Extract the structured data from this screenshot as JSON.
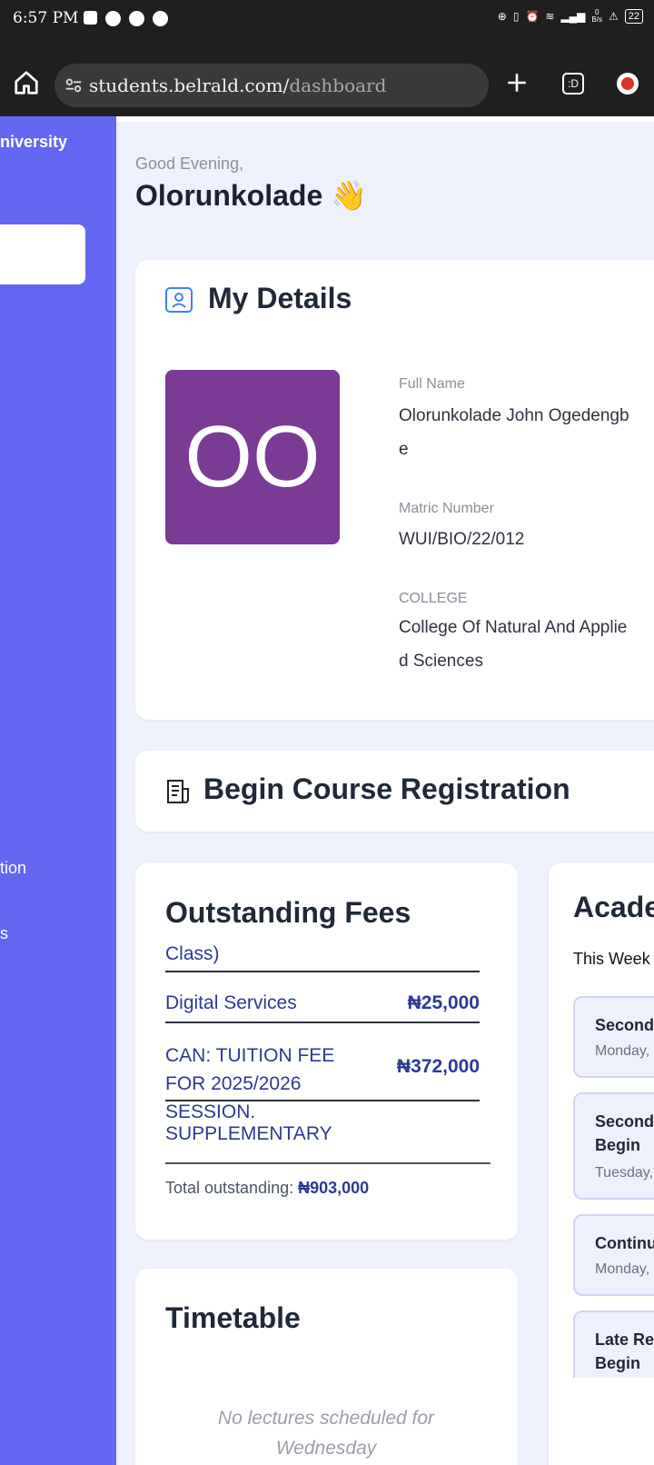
{
  "status_bar": {
    "time": "6:57 PM",
    "net_speed_value": "0",
    "net_speed_unit": "B/s",
    "battery": "22"
  },
  "browser": {
    "url_domain": "students.belrald.com/",
    "url_path": "dashboard",
    "tab_switcher_label": ":D"
  },
  "sidebar": {
    "brand": "niversity",
    "items": [
      {
        "label": "tion"
      },
      {
        "label": "s"
      }
    ]
  },
  "header": {
    "greeting": "Good Evening,",
    "name": "Olorunkolade 👋"
  },
  "details": {
    "title": "My Details",
    "avatar_initials": "OO",
    "full_name_label": "Full Name",
    "full_name": "Olorunkolade John Ogedengbe",
    "matric_label": "Matric Number",
    "matric_number": "WUI/BIO/22/012",
    "college_label": "COLLEGE",
    "college": "College Of Natural And Applied Sciences"
  },
  "course_registration": {
    "title": "Begin Course Registration"
  },
  "fees": {
    "title": "Outstanding Fees",
    "items": [
      {
        "name": "Class)",
        "amount": ""
      },
      {
        "name": "Digital Services",
        "amount": "₦25,000"
      },
      {
        "name": "CAN: TUITION FEE FOR 2025/2026 SESSION.",
        "amount": "₦372,000"
      },
      {
        "name": "SUPPLEMENTARY",
        "amount": ""
      }
    ],
    "total_label": "Total outstanding:",
    "total_value": "₦903,000"
  },
  "timetable": {
    "title": "Timetable",
    "empty_message": "No lectures scheduled for Wednesday"
  },
  "academic": {
    "title": "Acade",
    "week_label": "This Week",
    "events": [
      {
        "title": "Second",
        "date": "Monday,"
      },
      {
        "title": "Second",
        "title_line2": "Begin",
        "date": "Tuesday,"
      },
      {
        "title": "Continu",
        "date": "Monday,"
      },
      {
        "title": "Late Re",
        "title_line2": "Begin"
      }
    ]
  },
  "colors": {
    "sidebar": "#6366f1",
    "avatar": "#7b3a94",
    "fee_text": "#2b3a94",
    "background": "#eef1fb"
  }
}
